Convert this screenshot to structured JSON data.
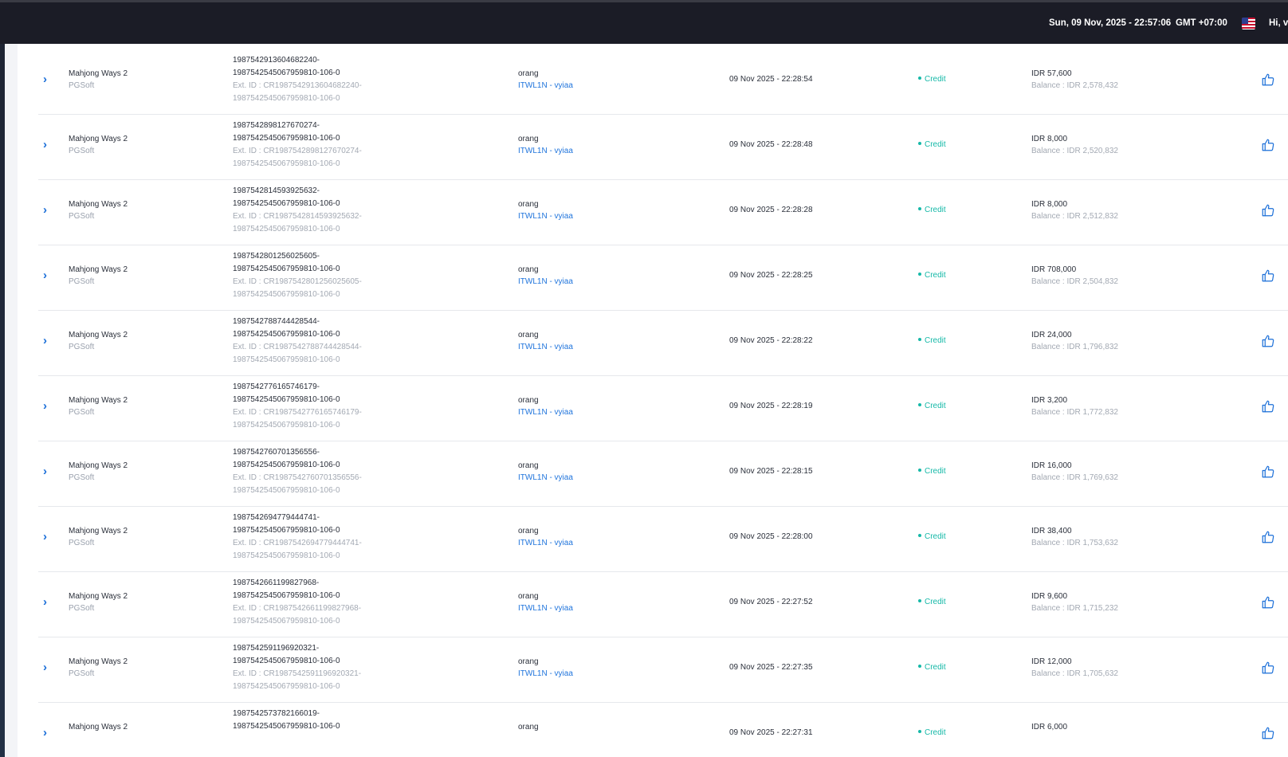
{
  "header": {
    "datetime": "Sun, 09 Nov, 2025 - 22:57:06",
    "timezone": "GMT +07:00",
    "greeting": "Hi, vy",
    "flag_icon": "us-flag-icon"
  },
  "colors": {
    "topbar": "#1b1c26",
    "accent_blue": "#1f74dc",
    "status_green": "#16b9a8",
    "muted_text": "#a3a9b3"
  },
  "rows": [
    {
      "game": "Mahjong Ways 2",
      "provider": "PGSoft",
      "tx_line1": "1987542913604682240-",
      "tx_line2": "1987542545067959810-106-0",
      "ext_line1": "Ext. ID : CR1987542913604682240-",
      "ext_line2": "1987542545067959810-106-0",
      "player": "orang",
      "agent": "ITWL1N - vyiaa",
      "datetime": "09 Nov 2025 - 22:28:54",
      "status": "Credit",
      "amount": "IDR 57,600",
      "balance": "Balance : IDR 2,578,432"
    },
    {
      "game": "Mahjong Ways 2",
      "provider": "PGSoft",
      "tx_line1": "1987542898127670274-",
      "tx_line2": "1987542545067959810-106-0",
      "ext_line1": "Ext. ID : CR1987542898127670274-",
      "ext_line2": "1987542545067959810-106-0",
      "player": "orang",
      "agent": "ITWL1N - vyiaa",
      "datetime": "09 Nov 2025 - 22:28:48",
      "status": "Credit",
      "amount": "IDR 8,000",
      "balance": "Balance : IDR 2,520,832"
    },
    {
      "game": "Mahjong Ways 2",
      "provider": "PGSoft",
      "tx_line1": "1987542814593925632-",
      "tx_line2": "1987542545067959810-106-0",
      "ext_line1": "Ext. ID : CR1987542814593925632-",
      "ext_line2": "1987542545067959810-106-0",
      "player": "orang",
      "agent": "ITWL1N - vyiaa",
      "datetime": "09 Nov 2025 - 22:28:28",
      "status": "Credit",
      "amount": "IDR 8,000",
      "balance": "Balance : IDR 2,512,832"
    },
    {
      "game": "Mahjong Ways 2",
      "provider": "PGSoft",
      "tx_line1": "1987542801256025605-",
      "tx_line2": "1987542545067959810-106-0",
      "ext_line1": "Ext. ID : CR1987542801256025605-",
      "ext_line2": "1987542545067959810-106-0",
      "player": "orang",
      "agent": "ITWL1N - vyiaa",
      "datetime": "09 Nov 2025 - 22:28:25",
      "status": "Credit",
      "amount": "IDR 708,000",
      "balance": "Balance : IDR 2,504,832"
    },
    {
      "game": "Mahjong Ways 2",
      "provider": "PGSoft",
      "tx_line1": "1987542788744428544-",
      "tx_line2": "1987542545067959810-106-0",
      "ext_line1": "Ext. ID : CR1987542788744428544-",
      "ext_line2": "1987542545067959810-106-0",
      "player": "orang",
      "agent": "ITWL1N - vyiaa",
      "datetime": "09 Nov 2025 - 22:28:22",
      "status": "Credit",
      "amount": "IDR 24,000",
      "balance": "Balance : IDR 1,796,832"
    },
    {
      "game": "Mahjong Ways 2",
      "provider": "PGSoft",
      "tx_line1": "1987542776165746179-",
      "tx_line2": "1987542545067959810-106-0",
      "ext_line1": "Ext. ID : CR1987542776165746179-",
      "ext_line2": "1987542545067959810-106-0",
      "player": "orang",
      "agent": "ITWL1N - vyiaa",
      "datetime": "09 Nov 2025 - 22:28:19",
      "status": "Credit",
      "amount": "IDR 3,200",
      "balance": "Balance : IDR 1,772,832"
    },
    {
      "game": "Mahjong Ways 2",
      "provider": "PGSoft",
      "tx_line1": "1987542760701356556-",
      "tx_line2": "1987542545067959810-106-0",
      "ext_line1": "Ext. ID : CR1987542760701356556-",
      "ext_line2": "1987542545067959810-106-0",
      "player": "orang",
      "agent": "ITWL1N - vyiaa",
      "datetime": "09 Nov 2025 - 22:28:15",
      "status": "Credit",
      "amount": "IDR 16,000",
      "balance": "Balance : IDR 1,769,632"
    },
    {
      "game": "Mahjong Ways 2",
      "provider": "PGSoft",
      "tx_line1": "1987542694779444741-",
      "tx_line2": "1987542545067959810-106-0",
      "ext_line1": "Ext. ID : CR1987542694779444741-",
      "ext_line2": "1987542545067959810-106-0",
      "player": "orang",
      "agent": "ITWL1N - vyiaa",
      "datetime": "09 Nov 2025 - 22:28:00",
      "status": "Credit",
      "amount": "IDR 38,400",
      "balance": "Balance : IDR 1,753,632"
    },
    {
      "game": "Mahjong Ways 2",
      "provider": "PGSoft",
      "tx_line1": "1987542661199827968-",
      "tx_line2": "1987542545067959810-106-0",
      "ext_line1": "Ext. ID : CR1987542661199827968-",
      "ext_line2": "1987542545067959810-106-0",
      "player": "orang",
      "agent": "ITWL1N - vyiaa",
      "datetime": "09 Nov 2025 - 22:27:52",
      "status": "Credit",
      "amount": "IDR 9,600",
      "balance": "Balance : IDR 1,715,232"
    },
    {
      "game": "Mahjong Ways 2",
      "provider": "PGSoft",
      "tx_line1": "1987542591196920321-",
      "tx_line2": "1987542545067959810-106-0",
      "ext_line1": "Ext. ID : CR1987542591196920321-",
      "ext_line2": "1987542545067959810-106-0",
      "player": "orang",
      "agent": "ITWL1N - vyiaa",
      "datetime": "09 Nov 2025 - 22:27:35",
      "status": "Credit",
      "amount": "IDR 12,000",
      "balance": "Balance : IDR 1,705,632"
    },
    {
      "game": "Mahjong Ways 2",
      "provider": "",
      "tx_line1": "1987542573782166019-",
      "tx_line2": "1987542545067959810-106-0",
      "ext_line1": "",
      "ext_line2": "",
      "player": "orang",
      "agent": "",
      "datetime": "09 Nov 2025 - 22:27:31",
      "status": "Credit",
      "amount": "IDR 6,000",
      "balance": ""
    }
  ]
}
